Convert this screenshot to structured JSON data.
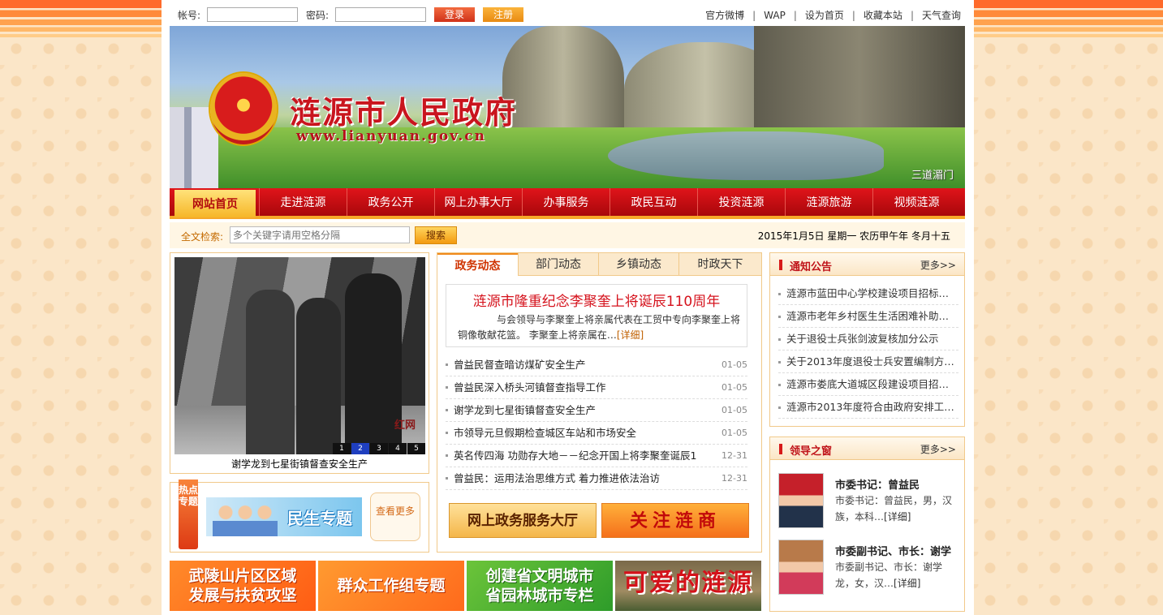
{
  "topbar": {
    "account_label": "帐号:",
    "password_label": "密码:",
    "account_value": "",
    "password_value": "",
    "login_label": "登录",
    "register_label": "注册",
    "links": [
      "官方微博",
      "WAP",
      "设为首页",
      "收藏本站",
      "天气查询"
    ],
    "separator": "|"
  },
  "banner": {
    "title": "涟源市人民政府",
    "url": "www.lianyuan.gov.cn",
    "caption": "三道湄门"
  },
  "nav": {
    "items": [
      "网站首页",
      "走进涟源",
      "政务公开",
      "网上办事大厅",
      "办事服务",
      "政民互动",
      "投资涟源",
      "涟源旅游",
      "视频涟源"
    ],
    "active_index": 0
  },
  "search": {
    "label": "全文检索:",
    "placeholder": "多个关键字请用空格分隔",
    "button_label": "搜索",
    "date_text": "2015年1月5日  星期一  农历甲午年 冬月十五"
  },
  "photo_news": {
    "watermark": "红网",
    "pages": [
      "1",
      "2",
      "3",
      "4",
      "5"
    ],
    "active_page": "2",
    "caption": "谢学龙到七星街镇督查安全生产"
  },
  "hot_topics": {
    "tag": "热点专题",
    "banner_text": "民生专题",
    "more_label": "查看更多"
  },
  "news": {
    "tabs": [
      "政务动态",
      "部门动态",
      "乡镇动态",
      "时政天下"
    ],
    "active_tab": 0,
    "headline": "涟源市隆重纪念李聚奎上将诞辰110周年",
    "summary": "与会领导与李聚奎上将亲属代表在工贸中专向李聚奎上将铜像敬献花篮。        李聚奎上将亲属在…",
    "detail_label": "[详细]",
    "items": [
      {
        "title": "曾益民督查暗访煤矿安全生产",
        "date": "01-05"
      },
      {
        "title": "曾益民深入桥头河镇督查指导工作",
        "date": "01-05"
      },
      {
        "title": "谢学龙到七星街镇督查安全生产",
        "date": "01-05"
      },
      {
        "title": "市领导元旦假期检查城区车站和市场安全",
        "date": "01-05"
      },
      {
        "title": "英名传四海 功勋存大地－－纪念开国上将李聚奎诞辰1…",
        "date": "12-31"
      },
      {
        "title": "曾益民：运用法治思维方式 着力推进依法治访",
        "date": "12-31"
      }
    ],
    "banner_service": "网上政务服务大厅",
    "banner_invest": "关注涟商"
  },
  "notice": {
    "title": "通知公告",
    "more": "更多>>",
    "items": [
      "涟源市蓝田中心学校建设项目招标…",
      "涟源市老年乡村医生生活困难补助…",
      "关于退役士兵张剑波复核加分公示",
      "关于2013年度退役士兵安置编制方…",
      "涟源市娄底大道城区段建设项目招…",
      "涟源市2013年度符合由政府安排工…"
    ]
  },
  "leaders": {
    "title": "领导之窗",
    "more": "更多>>",
    "items": [
      {
        "name": "市委书记：曾益民",
        "desc": "市委书记：曾益民，男，汉族，本科…",
        "detail": "[详细]"
      },
      {
        "name": "市委副书记、市长：谢学",
        "desc": "市委副书记、市长：谢学龙，女，汉…",
        "detail": "[详细]"
      }
    ]
  },
  "bottom_banners": [
    {
      "line1": "武陵山片区区域",
      "line2": "发展与扶贫攻坚"
    },
    {
      "line1": "群众工作组专题",
      "line2": ""
    },
    {
      "line1": "创建省文明城市",
      "line2": "省园林城市专栏"
    },
    {
      "line1": "可爱的涟源",
      "line2": ""
    }
  ]
}
